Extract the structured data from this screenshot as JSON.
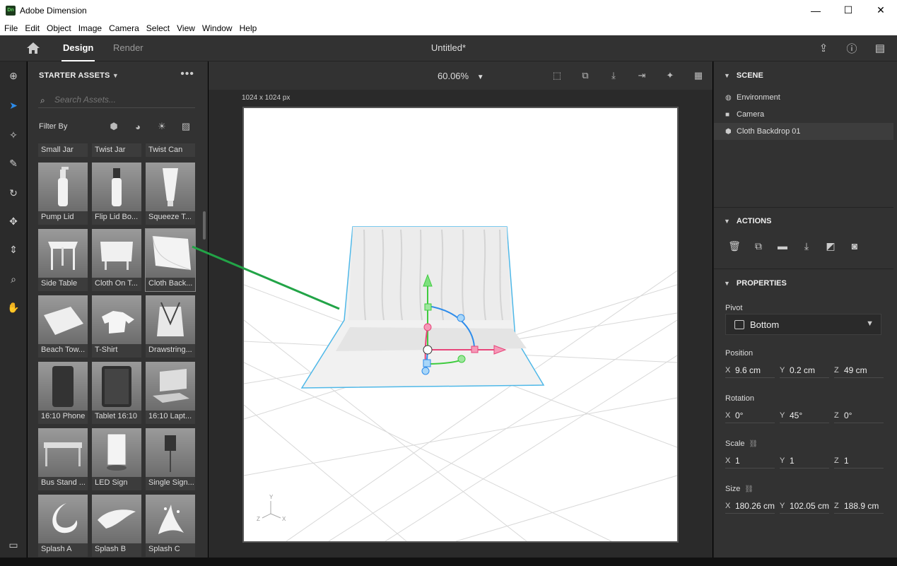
{
  "window": {
    "app_title": "Adobe Dimension",
    "logo_text": "Dn",
    "minimize": "—",
    "maximize": "☐",
    "close": "✕"
  },
  "menu": [
    "File",
    "Edit",
    "Object",
    "Image",
    "Camera",
    "Select",
    "View",
    "Window",
    "Help"
  ],
  "top": {
    "tab_design": "Design",
    "tab_render": "Render",
    "doc_title": "Untitled*"
  },
  "icons": {
    "home": "home-icon",
    "share": "share-icon",
    "help": "help-icon",
    "feedback": "feedback-icon"
  },
  "assets": {
    "header": "STARTER ASSETS",
    "search_placeholder": "Search Assets...",
    "filter_label": "Filter By",
    "items": [
      "Small Jar",
      "Twist Jar",
      "Twist Can",
      "Pump Lid",
      "Flip Lid Bo...",
      "Squeeze T...",
      "Side Table",
      "Cloth On T...",
      "Cloth Back...",
      "Beach Tow...",
      "T-Shirt",
      "Drawstring...",
      "16:10 Phone",
      "Tablet 16:10",
      "16:10 Lapt...",
      "Bus Stand ...",
      "LED Sign",
      "Single Sign...",
      "Splash A",
      "Splash B",
      "Splash C"
    ]
  },
  "viewport": {
    "zoom": "60.06%",
    "canvas_size": "1024 x 1024 px"
  },
  "scene": {
    "header": "SCENE",
    "items": [
      "Environment",
      "Camera",
      "Cloth Backdrop 01"
    ]
  },
  "actions": {
    "header": "ACTIONS"
  },
  "properties": {
    "header": "PROPERTIES",
    "pivot_label": "Pivot",
    "pivot_value": "Bottom",
    "position_label": "Position",
    "position": {
      "x": "9.6 cm",
      "y": "0.2 cm",
      "z": "49 cm"
    },
    "rotation_label": "Rotation",
    "rotation": {
      "x": "0°",
      "y": "45°",
      "z": "0°"
    },
    "scale_label": "Scale",
    "scale": {
      "x": "1",
      "y": "1",
      "z": "1"
    },
    "size_label": "Size",
    "size": {
      "x": "180.26 cm",
      "y": "102.05 cm",
      "z": "188.9 cm"
    }
  },
  "axes": {
    "x": "X",
    "y": "Y",
    "z": "Z"
  },
  "colors": {
    "accent": "#2d8ceb",
    "selection_outline": "#4fb8e8",
    "drag_line": "#22a447",
    "gizmo_x": "#e8457a",
    "gizmo_y": "#3ecb3e",
    "gizmo_z": "#2d8ceb"
  }
}
